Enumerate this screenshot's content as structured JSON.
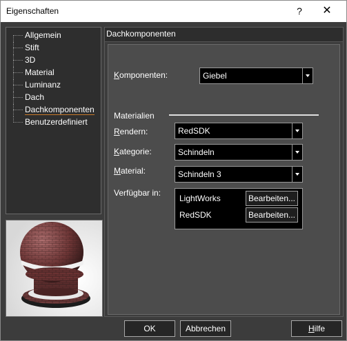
{
  "window": {
    "title": "Eigenschaften",
    "help_glyph": "?",
    "close_glyph": "✕"
  },
  "tree": {
    "items": [
      {
        "label": "Allgemein"
      },
      {
        "label": "Stift"
      },
      {
        "label": "3D"
      },
      {
        "label": "Material"
      },
      {
        "label": "Luminanz"
      },
      {
        "label": "Dach"
      },
      {
        "label": "Dachkomponenten",
        "selected": true
      },
      {
        "label": "Benutzerdefiniert"
      }
    ]
  },
  "panel": {
    "header": "Dachkomponenten",
    "komponenten": {
      "label_u": "K",
      "label_rest": "omponenten:",
      "value": "Giebel"
    },
    "materialien_label": "Materialien",
    "rendern": {
      "label_u": "R",
      "label_rest": "endern:",
      "value": "RedSDK"
    },
    "kategorie": {
      "label_u": "K",
      "label_rest": "ategorie:",
      "value": "Schindeln"
    },
    "material": {
      "label_u": "M",
      "label_rest": "aterial:",
      "value": "Schindeln 3"
    },
    "verfuegbar": {
      "label": "Verfügbar in:",
      "rows": [
        {
          "name": "LightWorks",
          "button": "Bearbeiten..."
        },
        {
          "name": "RedSDK",
          "button": "Bearbeiten..."
        }
      ]
    }
  },
  "footer": {
    "ok": "OK",
    "cancel": "Abbrechen",
    "help_u": "H",
    "help_rest": "ilfe"
  },
  "colors": {
    "background": "#3c3c3c",
    "field": "#000000",
    "accent": "#c97b2a"
  }
}
